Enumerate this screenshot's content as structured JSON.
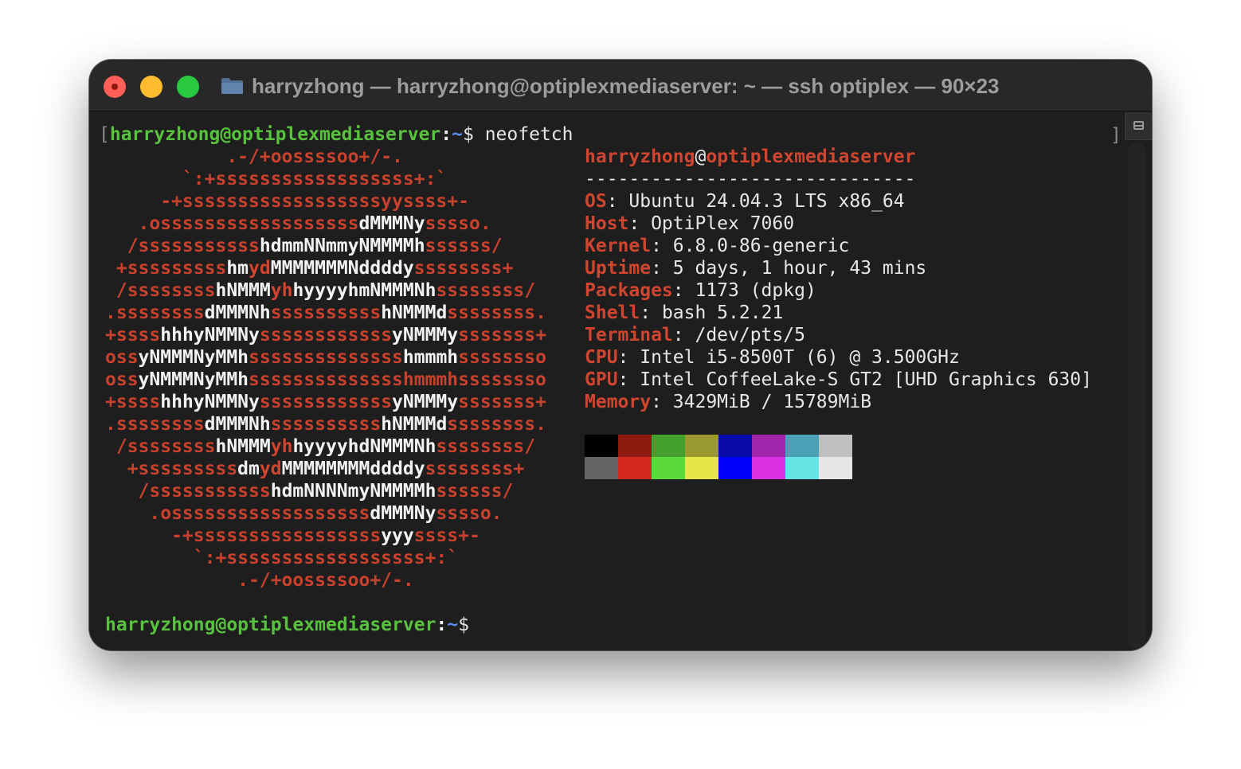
{
  "window": {
    "title": "harryzhong — harryzhong@optiplexmediaserver: ~ — ssh optiplex — 90×23"
  },
  "prompt": {
    "user_host": "harryzhong@optiplexmediaserver",
    "colon": ":",
    "path": "~",
    "symbol": "$",
    "command": " neofetch",
    "open_bracket": "[",
    "close_bracket": "]"
  },
  "logo": [
    [
      [
        "r",
        "           .-/+oossssoo+/-."
      ]
    ],
    [
      [
        "r",
        "       `:+ssssssssssssssssss+:`"
      ]
    ],
    [
      [
        "r",
        "     -+ssssssssssssssssssyyssss+-"
      ]
    ],
    [
      [
        "r",
        "   .ossssssssssssssssss"
      ],
      [
        "w",
        "dMMMNy"
      ],
      [
        "r",
        "sssso."
      ]
    ],
    [
      [
        "r",
        "  /sssssssssss"
      ],
      [
        "w",
        "hdmmNNmmyNMMMMh"
      ],
      [
        "r",
        "ssssss/"
      ]
    ],
    [
      [
        "r",
        " +sssssssss"
      ],
      [
        "w",
        "hm"
      ],
      [
        "o",
        "yd"
      ],
      [
        "w",
        "MMMMMMMNddddy"
      ],
      [
        "r",
        "ssssssss+"
      ]
    ],
    [
      [
        "r",
        " /ssssssss"
      ],
      [
        "w",
        "hNMMM"
      ],
      [
        "o",
        "yh"
      ],
      [
        "w",
        "hyyyyhmNMMMNh"
      ],
      [
        "r",
        "ssssssss/"
      ]
    ],
    [
      [
        "r",
        ".ssssssss"
      ],
      [
        "w",
        "dMMMNh"
      ],
      [
        "r",
        "ssssssssss"
      ],
      [
        "w",
        "hNMMMd"
      ],
      [
        "r",
        "ssssssss."
      ]
    ],
    [
      [
        "r",
        "+ssss"
      ],
      [
        "w",
        "hhhyNMMNy"
      ],
      [
        "r",
        "ssssssssssss"
      ],
      [
        "w",
        "yNMMMy"
      ],
      [
        "r",
        "sssssss+"
      ]
    ],
    [
      [
        "r",
        "oss"
      ],
      [
        "w",
        "yNMMMNyMMh"
      ],
      [
        "r",
        "ssssssssssssss"
      ],
      [
        "w",
        "hmmmh"
      ],
      [
        "r",
        "ssssssso"
      ]
    ],
    [
      [
        "r",
        "oss"
      ],
      [
        "w",
        "yNMMMNyMMh"
      ],
      [
        "r",
        "sssssssssssssshmmmhssssssso"
      ]
    ],
    [
      [
        "r",
        "+ssss"
      ],
      [
        "w",
        "hhhyNMMNy"
      ],
      [
        "r",
        "ssssssssssss"
      ],
      [
        "w",
        "yNMMMy"
      ],
      [
        "r",
        "sssssss+"
      ]
    ],
    [
      [
        "r",
        ".ssssssss"
      ],
      [
        "w",
        "dMMMNh"
      ],
      [
        "r",
        "ssssssssss"
      ],
      [
        "w",
        "hNMMMd"
      ],
      [
        "r",
        "ssssssss."
      ]
    ],
    [
      [
        "r",
        " /ssssssss"
      ],
      [
        "w",
        "hNMMM"
      ],
      [
        "o",
        "yh"
      ],
      [
        "w",
        "hyyyyhdNMMMNh"
      ],
      [
        "r",
        "ssssssss/"
      ]
    ],
    [
      [
        "r",
        "  +sssssssss"
      ],
      [
        "w",
        "dm"
      ],
      [
        "o",
        "yd"
      ],
      [
        "w",
        "MMMMMMMMddddy"
      ],
      [
        "r",
        "ssssssss+"
      ]
    ],
    [
      [
        "r",
        "   /sssssssssss"
      ],
      [
        "w",
        "hdmNNNNmyNMMMMh"
      ],
      [
        "r",
        "ssssss/"
      ]
    ],
    [
      [
        "r",
        "    .ossssssssssssssssss"
      ],
      [
        "w",
        "dMMMNy"
      ],
      [
        "r",
        "sssso."
      ]
    ],
    [
      [
        "r",
        "      -+sssssssssssssssss"
      ],
      [
        "w",
        "yyy"
      ],
      [
        "r",
        "ssss+-"
      ]
    ],
    [
      [
        "r",
        "        `:+ssssssssssssssssss+:`"
      ]
    ],
    [
      [
        "r",
        "            .-/+oossssoo+/-."
      ]
    ]
  ],
  "info": {
    "user": "harryzhong",
    "at": "@",
    "host": "optiplexmediaserver",
    "separator": "------------------------------",
    "fields": [
      {
        "key": "OS",
        "value": ": Ubuntu 24.04.3 LTS x86_64"
      },
      {
        "key": "Host",
        "value": ": OptiPlex 7060"
      },
      {
        "key": "Kernel",
        "value": ": 6.8.0-86-generic"
      },
      {
        "key": "Uptime",
        "value": ": 5 days, 1 hour, 43 mins"
      },
      {
        "key": "Packages",
        "value": ": 1173 (dpkg)"
      },
      {
        "key": "Shell",
        "value": ": bash 5.2.21"
      },
      {
        "key": "Terminal",
        "value": ": /dev/pts/5"
      },
      {
        "key": "CPU",
        "value": ": Intel i5-8500T (6) @ 3.500GHz"
      },
      {
        "key": "GPU",
        "value": ": Intel CoffeeLake-S GT2 [UHD Graphics 630]"
      },
      {
        "key": "Memory",
        "value": ": 3429MiB / 15789MiB"
      }
    ]
  },
  "palette": {
    "normal": [
      "#000000",
      "#8e1a10",
      "#44a02c",
      "#9a9a30",
      "#0a0aa8",
      "#a024ac",
      "#4aa0b4",
      "#c0c0c0"
    ],
    "bright": [
      "#646464",
      "#d42a1e",
      "#5ada3c",
      "#e6e64a",
      "#0000fa",
      "#da30e4",
      "#64e4e4",
      "#e6e6e6"
    ]
  },
  "colors": {
    "prompt_user": "#58c23f",
    "prompt_path": "#5c8cf0",
    "accent_red": "#d0452f",
    "window_bg": "#1e1e1e"
  },
  "icons": {
    "folder": "folder-icon",
    "scroll_button": "scroll-marks-icon"
  }
}
